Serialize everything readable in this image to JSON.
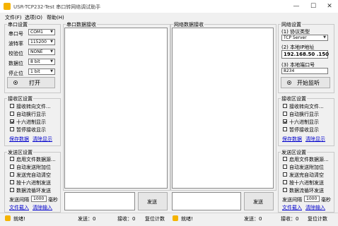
{
  "window": {
    "title": "USR-TCP232-Test 串口转网络调试助手",
    "minimize": "—",
    "maximize": "☐",
    "close": "✕"
  },
  "menu": [
    "文件(F)",
    "选项(O)",
    "帮助(H)"
  ],
  "serial_settings": {
    "title": "串口设置",
    "fields": [
      {
        "label": "串口号",
        "value": "COM1"
      },
      {
        "label": "波特率",
        "value": "115200"
      },
      {
        "label": "校验位",
        "value": "NONE"
      },
      {
        "label": "数据位",
        "value": "8 bit"
      },
      {
        "label": "停止位",
        "value": "1 bit"
      }
    ],
    "open_button": "打开"
  },
  "left_recv": {
    "title": "接收区设置",
    "options": [
      {
        "label": "接收转向文件...",
        "checked": false
      },
      {
        "label": "自动换行显示",
        "checked": false
      },
      {
        "label": "十六进制显示",
        "checked": true
      },
      {
        "label": "暂停接收显示",
        "checked": false
      }
    ],
    "save_link": "保存数据",
    "clear_link": "清除显示"
  },
  "left_send": {
    "title": "发送区设置",
    "options": [
      {
        "label": "启用文件数据源...",
        "checked": false
      },
      {
        "label": "自动发送附加位",
        "checked": false
      },
      {
        "label": "发送完自动清空",
        "checked": false
      },
      {
        "label": "按十六进制发送",
        "checked": false
      },
      {
        "label": "数据流循环发送",
        "checked": false
      }
    ],
    "interval_label": "发送间隔",
    "interval_value": "1000",
    "interval_unit": "毫秒",
    "file_link": "文件载入",
    "clear_link": "清除输入"
  },
  "serial_recv_panel": {
    "title": "串口数据接收"
  },
  "net_recv_panel": {
    "title": "网络数据接收"
  },
  "send_button_left": "发送",
  "send_button_right": "发送",
  "net_settings": {
    "title": "网络设置",
    "protocol_label": "(1) 协议类型",
    "protocol_value": "TCP Server",
    "ip_label": "(2) 本地IP地址",
    "ip_value": "192.168.50 .150",
    "port_label": "(3) 本地端口号",
    "port_value": "8234",
    "listen_button": "开始监听"
  },
  "right_recv": {
    "title": "接收区设置",
    "options": [
      {
        "label": "接收转向文件...",
        "checked": false
      },
      {
        "label": "自动换行显示",
        "checked": false
      },
      {
        "label": "十六进制显示",
        "checked": true
      },
      {
        "label": "暂停接收显示",
        "checked": false
      }
    ],
    "save_link": "保存数据",
    "clear_link": "清除显示"
  },
  "right_send": {
    "title": "发送区设置",
    "options": [
      {
        "label": "启用文件数据源...",
        "checked": false
      },
      {
        "label": "自动发送附加位",
        "checked": false
      },
      {
        "label": "发送完自动清空",
        "checked": false
      },
      {
        "label": "按十六进制发送",
        "checked": false
      },
      {
        "label": "数据流循环发送",
        "checked": false
      }
    ],
    "interval_label": "发送间隔",
    "interval_value": "1000",
    "interval_unit": "毫秒",
    "file_link": "文件载入",
    "clear_link": "清除输入"
  },
  "status_left": {
    "ready": "就绪!",
    "send": "发送：0",
    "recv": "接收：0",
    "reset": "复位计数"
  },
  "status_right": {
    "ready": "就绪!",
    "send": "发送：0",
    "recv": "接收：0",
    "reset": "复位计数"
  }
}
